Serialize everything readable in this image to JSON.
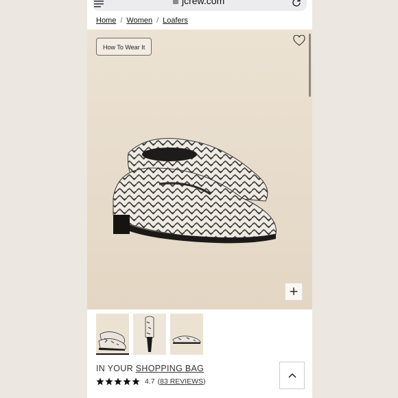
{
  "browser": {
    "url": "jcrew.com"
  },
  "breadcrumb": {
    "items": [
      "Home",
      "Women",
      "Loafers"
    ],
    "separator": "/"
  },
  "hero": {
    "how_to_wear_label": "How To Wear It",
    "plus_label": "+"
  },
  "thumbnails": {
    "count": 3,
    "active_index": 0
  },
  "bag": {
    "prefix": "IN YOUR",
    "link": "SHOPPING BAG"
  },
  "rating": {
    "stars_filled": 4.7,
    "value": "4.7",
    "open_paren": "(",
    "reviews_link": "83 REVIEWS",
    "close_paren": ")"
  },
  "colors": {
    "background": "#ece7e0",
    "hero_bg": "#e7dccb",
    "text": "#111111"
  }
}
